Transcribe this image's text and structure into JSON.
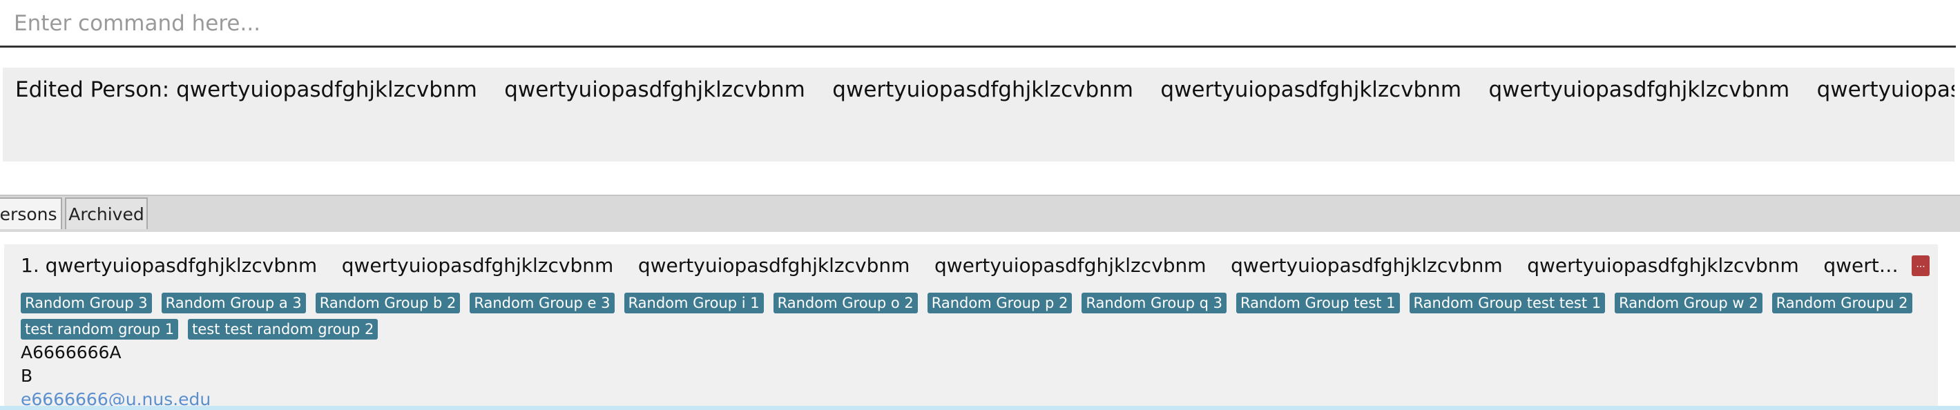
{
  "command_box": {
    "value": "",
    "placeholder": "Enter command here..."
  },
  "result_display": {
    "text": "Edited Person: qwertyuiopasdfghjklzcvbnm    qwertyuiopasdfghjklzcvbnm    qwertyuiopasdfghjklzcvbnm    qwertyuiopasdfghjklzcvbnm    qwertyuiopasdfghjklzcvbnm    qwertyuiopasdfghjklzc"
  },
  "tabs": [
    {
      "label": "Persons",
      "selected": true
    },
    {
      "label": "Archived",
      "selected": false
    }
  ],
  "persons": [
    {
      "index": "1.",
      "name": "qwertyuiopasdfghjklzcvbnm    qwertyuiopasdfghjklzcvbnm    qwertyuiopasdfghjklzcvbnm    qwertyuiopasdfghjklzcvbnm    qwertyuiopasdfghjklzcvbnm    qwertyuiopasdfghjklzcvbnm    qwertyuiopa...",
      "delete_label": "...",
      "tags": [
        "Random Group 3",
        "Random Group a 3",
        "Random Group b 2",
        "Random Group e 3",
        "Random Group i 1",
        "Random Group o 2",
        "Random Group p 2",
        "Random Group q 3",
        "Random Group test 1",
        "Random Group test test 1",
        "Random Group w 2",
        "Random Groupu 2",
        "test random group 1",
        "test test random group 2"
      ],
      "student_id": "A6666666A",
      "telegram": "B",
      "email": "e6666666@u.nus.edu"
    }
  ],
  "colors": {
    "tag_background": "#3e7b91",
    "delete_button": "#b23b3b",
    "email_link": "#5a8fd0",
    "selection_highlight": "#c7e6f6"
  }
}
